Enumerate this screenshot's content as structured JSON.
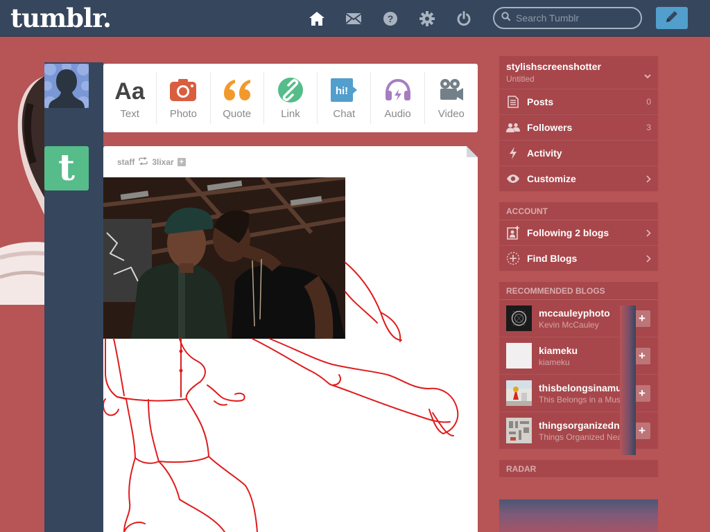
{
  "header": {
    "logo": "tumblr.",
    "search_placeholder": "Search Tumblr",
    "nav_icons": [
      "home-icon",
      "inbox-icon",
      "help-icon",
      "settings-icon",
      "logout-icon"
    ]
  },
  "colors": {
    "navy": "#36465d",
    "background": "#b65456",
    "compose_blue": "#529ecc",
    "staff_green": "#56bc8a"
  },
  "post_types": [
    {
      "label": "Text",
      "icon": "text-icon",
      "color": "#444444"
    },
    {
      "label": "Photo",
      "icon": "camera-icon",
      "color": "#d95e40"
    },
    {
      "label": "Quote",
      "icon": "quote-icon",
      "color": "#f2992e"
    },
    {
      "label": "Link",
      "icon": "link-icon",
      "color": "#56bc8a"
    },
    {
      "label": "Chat",
      "icon": "chat-icon",
      "color": "#529ecc"
    },
    {
      "label": "Audio",
      "icon": "headphones-icon",
      "color": "#a77dc2"
    },
    {
      "label": "Video",
      "icon": "video-camera-icon",
      "color": "#748089"
    }
  ],
  "post": {
    "author": "staff",
    "reblogged_from": "3lixar",
    "staff_avatar_letter": "t"
  },
  "sidebar": {
    "blog_name": "stylishscreenshotter",
    "blog_subtitle": "Untitled",
    "items": [
      {
        "label": "Posts",
        "count": "0",
        "icon": "posts-icon"
      },
      {
        "label": "Followers",
        "count": "3",
        "icon": "followers-icon"
      },
      {
        "label": "Activity",
        "count": "",
        "icon": "activity-icon"
      },
      {
        "label": "Customize",
        "count": "",
        "icon": "eye-icon"
      }
    ],
    "account_title": "ACCOUNT",
    "account_items": [
      {
        "label": "Following 2 blogs",
        "icon": "following-icon"
      },
      {
        "label": "Find Blogs",
        "icon": "find-blogs-icon"
      }
    ],
    "recommended_title": "RECOMMENDED BLOGS",
    "recommended": [
      {
        "name": "mccauleyphoto",
        "subtitle": "Kevin McCauley"
      },
      {
        "name": "kiameku",
        "subtitle": "kiameku"
      },
      {
        "name": "thisbelongsinamus",
        "subtitle": "This Belongs in a Mus"
      },
      {
        "name": "thingsorganizedne",
        "subtitle": "Things Organized Nea"
      }
    ],
    "radar_title": "RADAR"
  }
}
